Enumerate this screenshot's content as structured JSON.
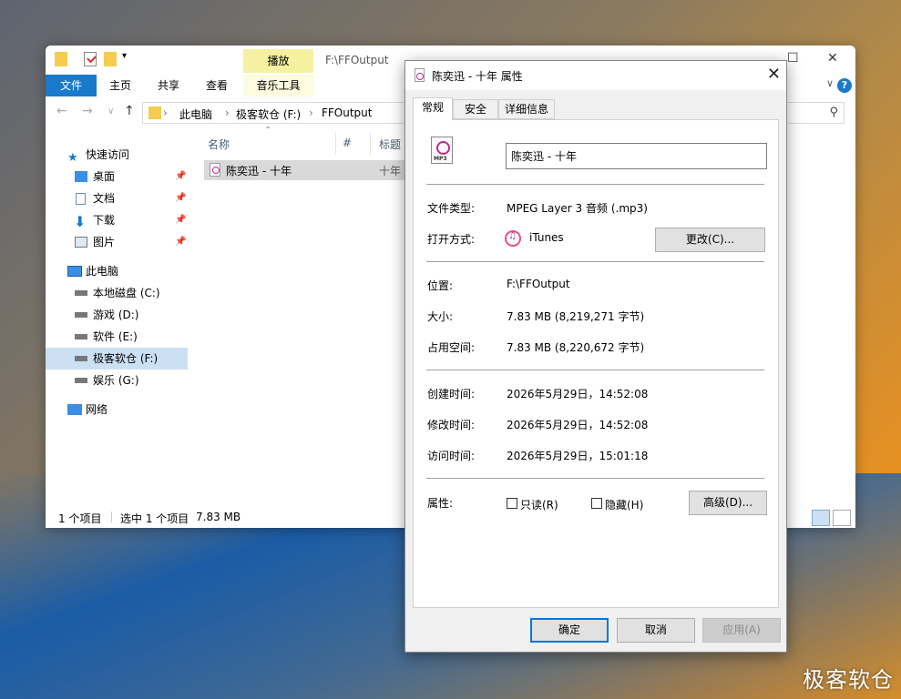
{
  "explorer": {
    "ribbon_context_tab": "播放",
    "ribbon_context_group": "音乐工具",
    "title_path": "F:\\FFOutput",
    "tabs": [
      "文件",
      "主页",
      "共享",
      "查看"
    ],
    "breadcrumb": [
      "此电脑",
      "极客软仓 (F:)",
      "FFOutput"
    ],
    "nav": {
      "quick_access": "快速访问",
      "desktop": "桌面",
      "documents": "文档",
      "downloads": "下载",
      "pictures": "图片",
      "this_pc": "此电脑",
      "drive_c": "本地磁盘 (C:)",
      "drive_d": "游戏 (D:)",
      "drive_e": "软件 (E:)",
      "drive_f": "极客软仓 (F:)",
      "drive_g": "娱乐 (G:)",
      "network": "网络"
    },
    "columns": {
      "name": "名称",
      "number": "#",
      "title": "标题"
    },
    "file": {
      "name": "陈奕迅 - 十年",
      "title": "十年"
    },
    "status": {
      "count": "1 个项目",
      "selected": "选中 1 个项目",
      "size": "7.83 MB"
    }
  },
  "dialog": {
    "title": "陈奕迅 - 十年 属性",
    "tabs": [
      "常规",
      "安全",
      "详细信息"
    ],
    "file_icon_text": "MP3",
    "name_value": "陈奕迅 - 十年",
    "file_type_label": "文件类型:",
    "file_type_value": "MPEG Layer 3 音频 (.mp3)",
    "open_with_label": "打开方式:",
    "open_with_value": "iTunes",
    "change_button": "更改(C)...",
    "location_label": "位置:",
    "location_value": "F:\\FFOutput",
    "size_label": "大小:",
    "size_value": "7.83 MB (8,219,271 字节)",
    "disk_size_label": "占用空间:",
    "disk_size_value": "7.83 MB (8,220,672 字节)",
    "created_label": "创建时间:",
    "created_value": "2026年5月29日，14:52:08",
    "modified_label": "修改时间:",
    "modified_value": "2026年5月29日，14:52:08",
    "accessed_label": "访问时间:",
    "accessed_value": "2026年5月29日，15:01:18",
    "attributes_label": "属性:",
    "readonly_label": "只读(R)",
    "hidden_label": "隐藏(H)",
    "advanced_button": "高级(D)...",
    "ok_button": "确定",
    "cancel_button": "取消",
    "apply_button": "应用(A)"
  },
  "watermark": "极客软仓",
  "colors": {
    "accent": "#1979ca",
    "selection": "#cce0f4",
    "context_tab": "#f6f1a0"
  }
}
